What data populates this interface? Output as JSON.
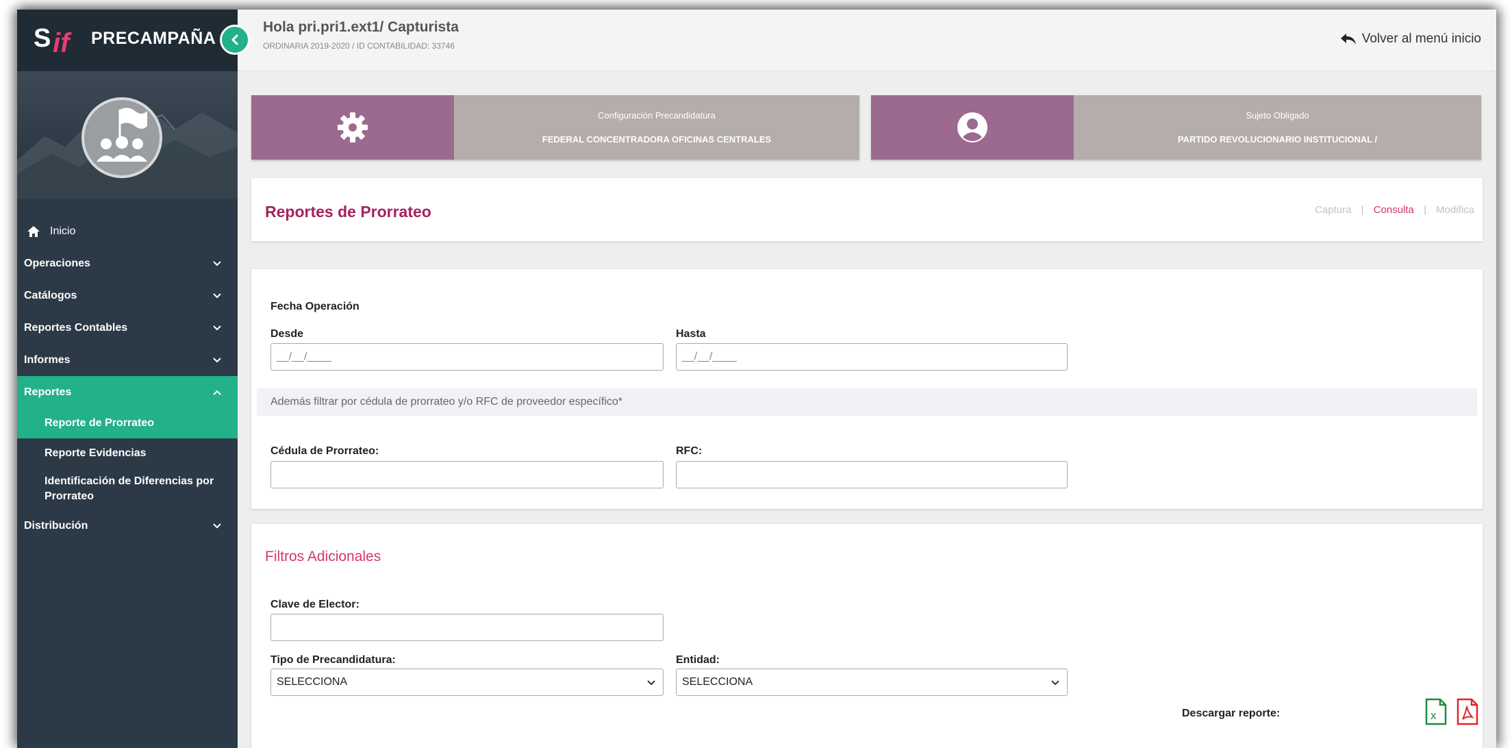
{
  "brand": {
    "logo_text": "SIF",
    "name": "PRECAMPAÑA"
  },
  "sidebar": {
    "home": "Inicio",
    "items": [
      {
        "label": "Operaciones"
      },
      {
        "label": "Catálogos"
      },
      {
        "label": "Reportes Contables"
      },
      {
        "label": "Informes"
      },
      {
        "label": "Reportes"
      }
    ],
    "sub_items": [
      {
        "label": "Reporte de Prorrateo"
      },
      {
        "label": "Reporte Evidencias"
      },
      {
        "label": "Identificación de Diferencias por Prorrateo"
      }
    ],
    "last_item": "Distribución"
  },
  "header": {
    "greeting": "Hola pri.pri1.ext1/ Capturista",
    "subtitle": "ORDINARIA 2019-2020 / ID CONTABILIDAD: 33746",
    "back_label": "Volver al menú inicio"
  },
  "info_cards": [
    {
      "title": "Configuración Precandidatura",
      "value": "FEDERAL CONCENTRADORA OFICINAS CENTRALES"
    },
    {
      "title": "Sujeto Obligado",
      "value": "PARTIDO REVOLUCIONARIO INSTITUCIONAL /"
    }
  ],
  "page": {
    "title": "Reportes de Prorrateo",
    "modes": {
      "captura": "Captura",
      "consulta": "Consulta",
      "modifica": "Modifica",
      "separator": "|"
    }
  },
  "form": {
    "fecha_label": "Fecha Operación",
    "desde_label": "Desde",
    "hasta_label": "Hasta",
    "date_mask": "__/__/____",
    "note": "Además filtrar por cédula de prorrateo y/o RFC de proveedor específico*",
    "cedula_label": "Cédula de Prorrateo:",
    "rfc_label": "RFC:"
  },
  "filters": {
    "title": "Filtros Adicionales",
    "clave_label": "Clave de Elector:",
    "tipo_label": "Tipo de Precandidatura:",
    "tipo_value": "SELECCIONA",
    "entidad_label": "Entidad:",
    "entidad_value": "SELECCIONA",
    "download_label": "Descargar reporte:"
  },
  "colors": {
    "sidebar_bg": "#2c3a47",
    "accent_green": "#22b18a",
    "card_purple": "#9b6a8e",
    "card_gray": "#b5adab",
    "title_magenta": "#a5225f",
    "link_pink": "#d2366e",
    "excel_green": "#1e8c3e",
    "pdf_red": "#e2242a"
  },
  "icons": {
    "home": "home-icon",
    "back": "reply-arrow-icon",
    "config": "gear-icon",
    "user": "user-circle-icon",
    "excel": "excel-file-icon",
    "pdf": "pdf-file-icon"
  }
}
